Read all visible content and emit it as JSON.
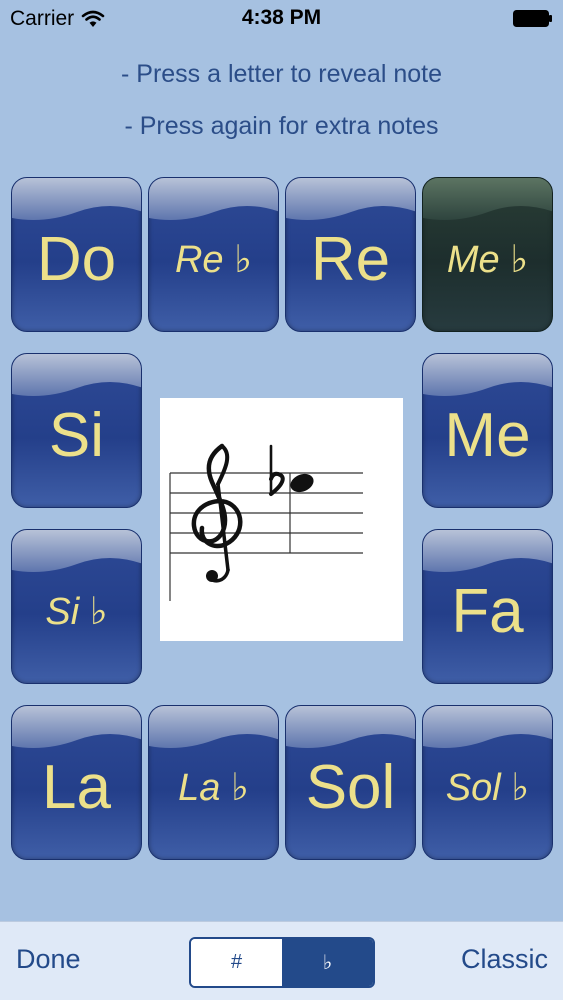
{
  "status_bar": {
    "carrier": "Carrier",
    "time": "4:38 PM"
  },
  "instructions": {
    "line1": "- Press a letter to reveal note",
    "line2": "- Press again for extra notes"
  },
  "keys": {
    "do": "Do",
    "re_flat": "Re ♭",
    "re": "Re",
    "me_flat": "Me ♭",
    "si": "Si",
    "me": "Me",
    "si_flat": "Si ♭",
    "fa": "Fa",
    "la": "La",
    "la_flat": "La ♭",
    "sol": "Sol",
    "sol_flat": "Sol ♭"
  },
  "selected_key": "me_flat",
  "staff": {
    "clef": "treble-clef",
    "accidental": "♭"
  },
  "toolbar": {
    "done": "Done",
    "sharp": "#",
    "flat": "♭",
    "classic": "Classic",
    "active_segment": "flat"
  },
  "colors": {
    "background": "#a6c1e1",
    "key_blue": "#2e4a96",
    "key_selected": "#1d2e2d",
    "label_yellow": "#ece08a",
    "accent": "#234a8a"
  }
}
